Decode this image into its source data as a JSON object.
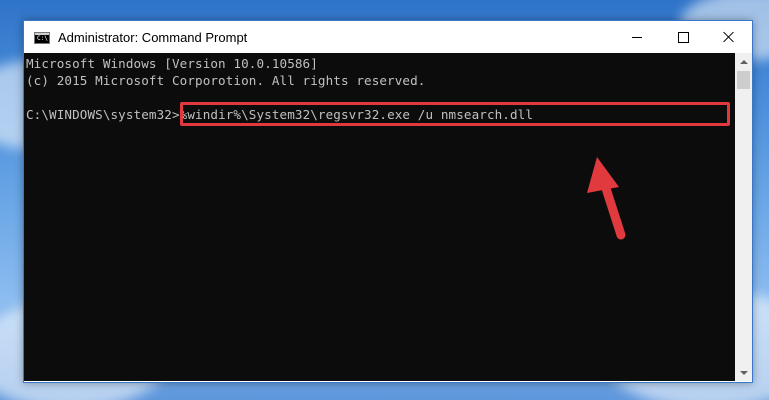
{
  "window": {
    "title": "Administrator: Command Prompt",
    "icon": "cmd-icon",
    "icon_glyph": "C:\\"
  },
  "titlebar_buttons": {
    "minimize": "minimize-icon",
    "maximize": "maximize-icon",
    "close": "close-icon"
  },
  "console": {
    "line1": "Microsoft Windows [Version 10.0.10586]",
    "line2": "(c) 2015 Microsoft Corporotion. All rights reserved.",
    "prompt": "C:\\WINDOWS\\system32>",
    "command": "%windir%\\System32\\regsvr32.exe /u nmsearch.dll",
    "text_color": "#c0c0c0",
    "background": "#0c0c0c"
  },
  "annotation": {
    "highlight_color": "#e0393e",
    "arrow_icon": "red-arrow-icon"
  },
  "scrollbar": {
    "up_icon": "scroll-up-icon",
    "down_icon": "scroll-down-icon"
  }
}
